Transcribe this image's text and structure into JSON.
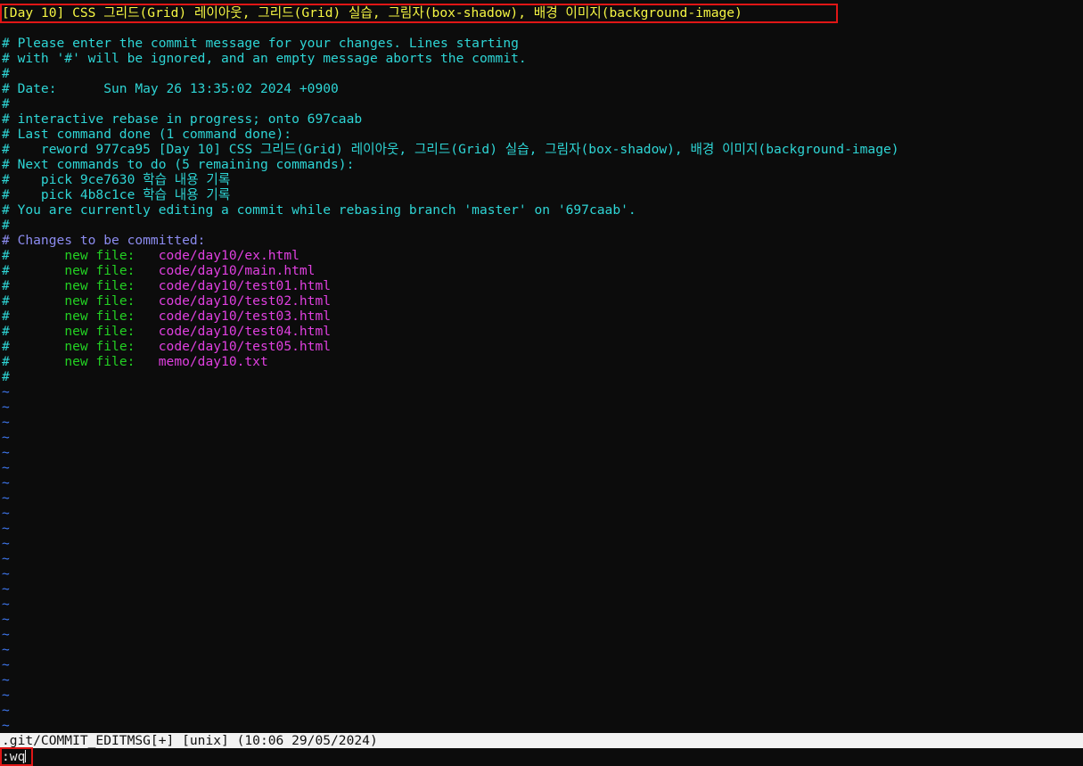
{
  "editor": {
    "title_line": "[Day 10] CSS 그리드(Grid) 레이아웃, 그리드(Grid) 실습, 그림자(box-shadow), 배경 이미지(background-image)",
    "comment_lines": [
      "# Please enter the commit message for your changes. Lines starting",
      "# with '#' will be ignored, and an empty message aborts the commit.",
      "#",
      "# Date:      Sun May 26 13:35:02 2024 +0900",
      "#",
      "# interactive rebase in progress; onto 697caab",
      "# Last command done (1 command done):",
      "#    reword 977ca95 [Day 10] CSS 그리드(Grid) 레이아웃, 그리드(Grid) 실습, 그림자(box-shadow), 배경 이미지(background-image)",
      "# Next commands to do (5 remaining commands):",
      "#    pick 9ce7630 학습 내용 기록",
      "#    pick 4b8c1ce 학습 내용 기록",
      "# You are currently editing a commit while rebasing branch 'master' on '697caab'.",
      "#"
    ],
    "changes_header": "# Changes to be committed:",
    "changes": [
      {
        "hash": "#",
        "status": "new file:",
        "path": "code/day10/ex.html"
      },
      {
        "hash": "#",
        "status": "new file:",
        "path": "code/day10/main.html"
      },
      {
        "hash": "#",
        "status": "new file:",
        "path": "code/day10/test01.html"
      },
      {
        "hash": "#",
        "status": "new file:",
        "path": "code/day10/test02.html"
      },
      {
        "hash": "#",
        "status": "new file:",
        "path": "code/day10/test03.html"
      },
      {
        "hash": "#",
        "status": "new file:",
        "path": "code/day10/test04.html"
      },
      {
        "hash": "#",
        "status": "new file:",
        "path": "code/day10/test05.html"
      },
      {
        "hash": "#",
        "status": "new file:",
        "path": "memo/day10.txt"
      }
    ],
    "trailing_hash": "#",
    "tilde": "~",
    "tilde_count": 23
  },
  "status_bar": {
    "text": ".git/COMMIT_EDITMSG[+] [unix] (10:06 29/05/2024)"
  },
  "command_line": {
    "text": ":wq"
  },
  "colors": {
    "background": "#0c0c0c",
    "title": "#f5f543",
    "comment": "#2ed5d5",
    "changes_header": "#8c8cf0",
    "status_new_file": "#23d123",
    "file_path": "#e040e0",
    "tilde": "#3f78f0",
    "highlight_box": "#e01616"
  }
}
